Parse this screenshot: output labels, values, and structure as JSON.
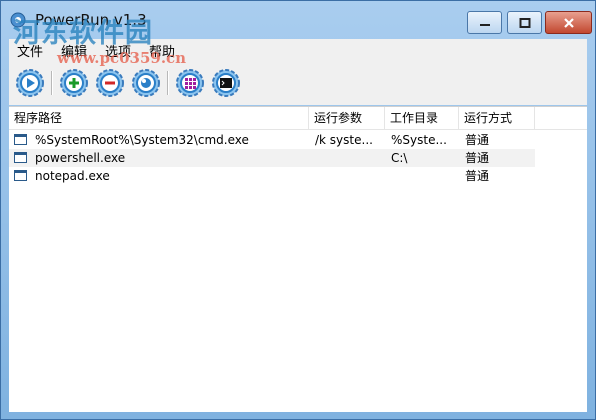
{
  "window": {
    "title": "PowerRun v1.3"
  },
  "watermark": {
    "text": "河东软件园",
    "url": "www.pc0359.cn"
  },
  "menu": [
    "文件",
    "编辑",
    "选项",
    "帮助"
  ],
  "toolbar": [
    {
      "name": "run-button-icon"
    },
    {
      "name": "add-button-icon"
    },
    {
      "name": "remove-button-icon"
    },
    {
      "name": "edit-button-icon"
    },
    {
      "name": "grid-button-icon"
    },
    {
      "name": "console-button-icon"
    }
  ],
  "table": {
    "columns": [
      "程序路径",
      "运行参数",
      "工作目录",
      "运行方式"
    ],
    "rows": [
      [
        "%SystemRoot%\\System32\\cmd.exe",
        "/k syste...",
        "%Syste...",
        "普通"
      ],
      [
        "powershell.exe",
        "",
        "C:\\",
        "普通"
      ],
      [
        "notepad.exe",
        "",
        "",
        "普通"
      ]
    ]
  },
  "colors": {
    "accent": "#2a7fc8",
    "add": "#1a9a2a",
    "remove": "#d02828"
  }
}
